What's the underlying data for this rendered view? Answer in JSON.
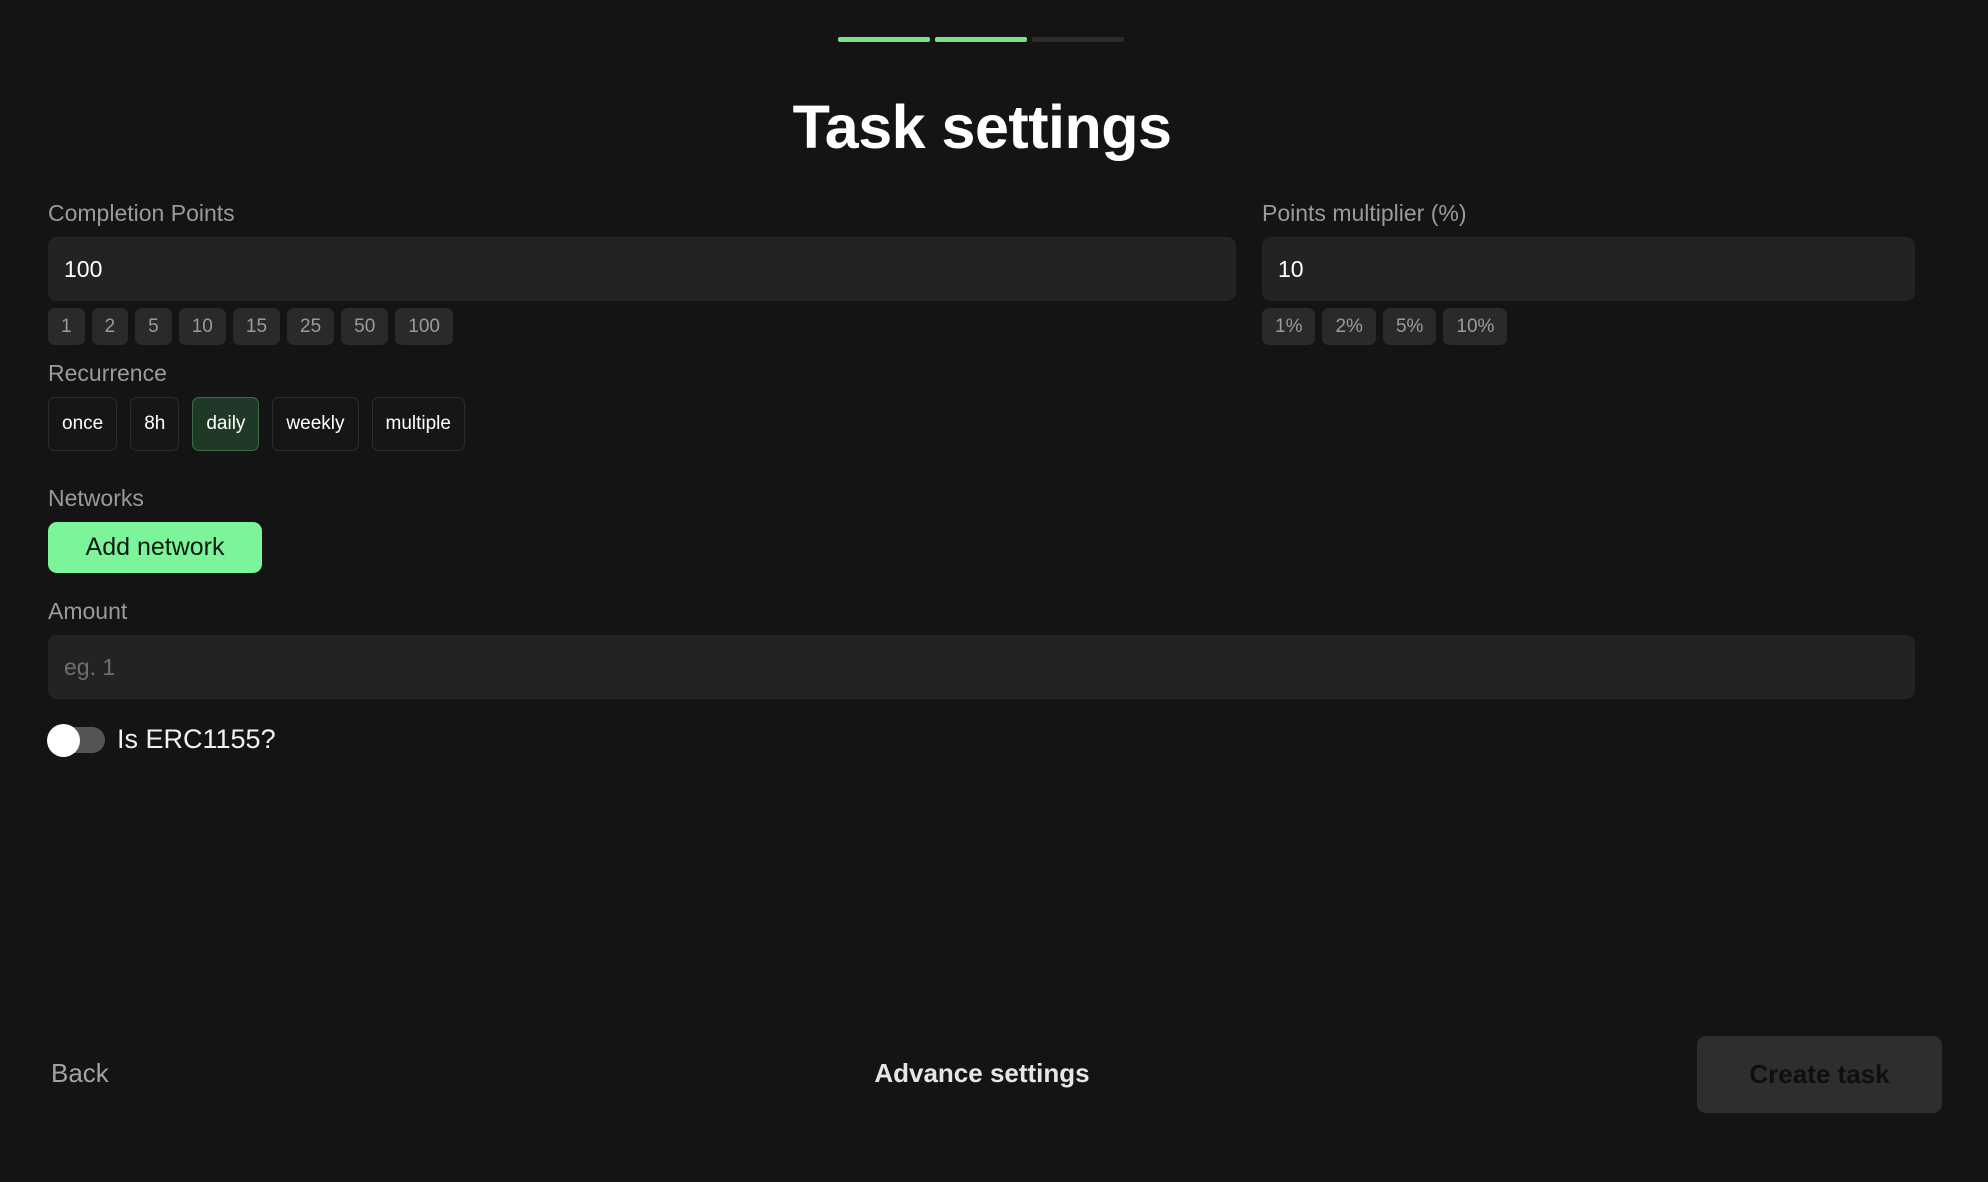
{
  "progress": {
    "total_steps": 3,
    "completed_steps": 2
  },
  "page_title": "Task settings",
  "completion_points": {
    "label": "Completion Points",
    "value": "100",
    "presets": [
      "1",
      "2",
      "5",
      "10",
      "15",
      "25",
      "50",
      "100"
    ]
  },
  "points_multiplier": {
    "label": "Points multiplier (%)",
    "value": "10",
    "presets": [
      "1%",
      "2%",
      "5%",
      "10%"
    ]
  },
  "recurrence": {
    "label": "Recurrence",
    "options": [
      "once",
      "8h",
      "daily",
      "weekly",
      "multiple"
    ],
    "selected": "daily"
  },
  "networks": {
    "label": "Networks",
    "add_button": "Add network"
  },
  "amount": {
    "label": "Amount",
    "value": "",
    "placeholder": "eg. 1"
  },
  "erc1155": {
    "label": "Is ERC1155?",
    "checked": false
  },
  "footer": {
    "back": "Back",
    "advance": "Advance settings",
    "create": "Create task"
  },
  "colors": {
    "accent": "#7cf59a",
    "progress_done": "#7be08c",
    "selected_bg": "#203826"
  }
}
